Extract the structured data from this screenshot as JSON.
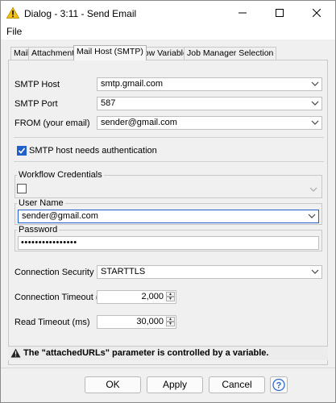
{
  "window": {
    "title": "Dialog - 3:11 - Send Email"
  },
  "menu": {
    "file": "File"
  },
  "tabs": [
    {
      "label": "Mail"
    },
    {
      "label": "Attachments"
    },
    {
      "label": "Mail Host (SMTP)",
      "active": true
    },
    {
      "label": "Flow Variables"
    },
    {
      "label": "Job Manager Selection"
    }
  ],
  "smtp": {
    "host_label": "SMTP Host",
    "host_value": "smtp.gmail.com",
    "port_label": "SMTP Port",
    "port_value": "587",
    "from_label": "FROM (your email)",
    "from_value": "sender@gmail.com",
    "auth_label": "SMTP host needs authentication",
    "auth_checked": true
  },
  "credentials": {
    "group_label": "Workflow Credentials",
    "checked": false,
    "username_label": "User Name",
    "username_value": "sender@gmail.com",
    "password_label": "Password",
    "password_value": "••••••••••••••••"
  },
  "connection": {
    "security_label": "Connection Security",
    "security_value": "STARTTLS",
    "timeout_label": "Connection Timeout (ms)",
    "timeout_value": "2,000",
    "read_label": "Read Timeout (ms)",
    "read_value": "30,000"
  },
  "warning": {
    "text": "The \"attachedURLs\" parameter is controlled by a variable."
  },
  "buttons": {
    "ok": "OK",
    "apply": "Apply",
    "cancel": "Cancel"
  },
  "colors": {
    "accent": "#2060c8",
    "warning": "#f0c020"
  }
}
